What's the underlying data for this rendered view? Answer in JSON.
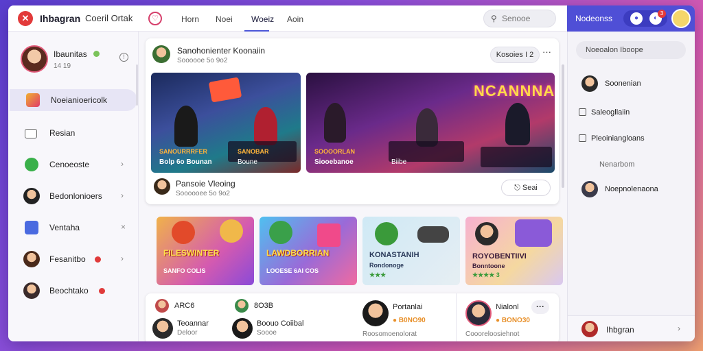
{
  "topbar": {
    "app_title": "Ihbagran",
    "sub_title": "Coeril Ortak",
    "nav_tabs": [
      "Horn",
      "Noei",
      "Woeiz",
      "Aoin"
    ],
    "search_placeholder": "Senooe"
  },
  "header_right": {
    "label": "Nodeonss",
    "notification_count": "3"
  },
  "profile": {
    "name": "Ibaunitas",
    "meta": "14 19"
  },
  "sidebar": {
    "items": [
      {
        "label": "Noeianioericolk"
      },
      {
        "label": "Resian"
      },
      {
        "label": "Cenoeoste"
      },
      {
        "label": "Bedonlonioers"
      },
      {
        "label": "Ventaha"
      },
      {
        "label": "Fesanitbo"
      },
      {
        "label": "Beochtako"
      }
    ]
  },
  "post": {
    "author": "Sanohonienter Koonaiin",
    "time": "Soooooe 5o 9o2",
    "pill_label": "Kosoies I 2",
    "media": [
      {
        "caption_top": "SANOURRRFER",
        "caption_bottom": "Bolp 6o Bounan",
        "caption_top_2": "SANOBAR",
        "caption_bottom_2": "Boune"
      },
      {
        "neon": "NCANNNAI",
        "caption_top": "SOOOORLAN",
        "caption_bottom": "Siooebanoe",
        "caption_bottom_2": "Biibe"
      }
    ],
    "footer_name": "Pansoie Vleoing",
    "footer_meta": "Soooooee 5o 9o2",
    "action_label": "Seai"
  },
  "games": [
    {
      "title": "FILESWINTER",
      "sub": "SANFO COLIS"
    },
    {
      "title": "LAWDBORRIAN",
      "sub": "LOOESE 6AI COS"
    },
    {
      "title": "KONASTANIH",
      "sub": "Rondonoge",
      "stars": "★★★"
    },
    {
      "title": "ROYOBENTIIVI",
      "sub": "Bonntoone",
      "stars": "★★★★ 3"
    }
  ],
  "bottom": {
    "cols": [
      {
        "top_name": "ARC6",
        "top_name_2": "8O3B",
        "name_a": "Teoannar",
        "sub_a": "Deloor",
        "name_b": "Boouo Coiibal",
        "sub_b": "Soooe"
      },
      {
        "name": "Portanlai",
        "coins": "B0NO90",
        "sub": "Roosomoenolorat"
      },
      {
        "name": "Nialonl",
        "coins": "BONO30",
        "sub": "Coooreloosiehnot"
      }
    ]
  },
  "right_panel": {
    "search_label": "Noeoalon Iboope",
    "items": [
      {
        "label": "Soonenian"
      },
      {
        "label": "Saleogllaiin"
      },
      {
        "label": "Pleoiniangloans"
      },
      {
        "label": "Nenarbom"
      },
      {
        "label": "Noepnolenaona"
      }
    ],
    "bottom_label": "Ihbgran"
  },
  "colors": {
    "accent": "#4f4fd6",
    "brand_red": "#e23a3a",
    "status_green": "#7bc35a"
  }
}
